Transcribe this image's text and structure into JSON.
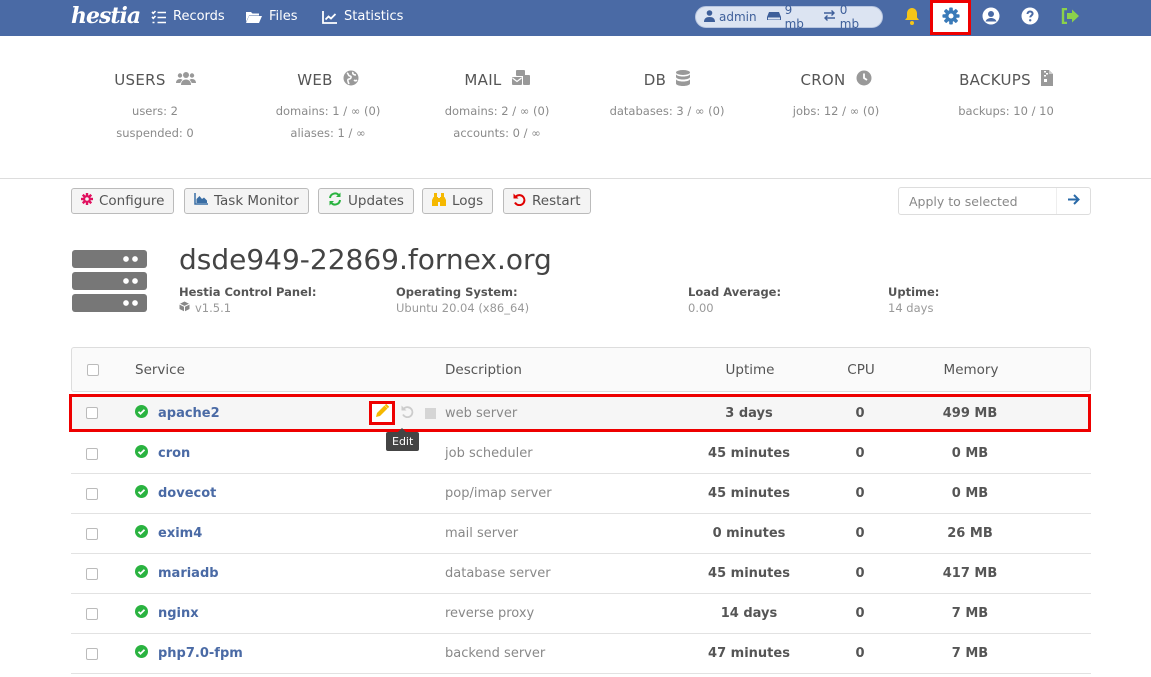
{
  "topbar": {
    "logo": "hestia",
    "nav": [
      {
        "label": "Records",
        "icon": "list-check-icon"
      },
      {
        "label": "Files",
        "icon": "folder-open-icon"
      },
      {
        "label": "Statistics",
        "icon": "chart-line-icon"
      }
    ],
    "user_pill": {
      "user": "admin",
      "disk": "9 mb",
      "bandwidth": "0 mb"
    },
    "icons": [
      "bell-icon",
      "gear-icon",
      "user-circle-icon",
      "question-icon",
      "logout-icon"
    ],
    "colors": {
      "bar": "#4a6aa5",
      "bell": "#f5c518",
      "gear": "#3a7ab8",
      "logout": "#8bd14b",
      "highlight": "#e00000"
    }
  },
  "stats": [
    {
      "title": "USERS",
      "icon": "users-icon",
      "lines": [
        "users: 2",
        "suspended: 0"
      ]
    },
    {
      "title": "WEB",
      "icon": "globe-icon",
      "lines": [
        "domains: 1 / ∞ (0)",
        "aliases: 1 / ∞"
      ]
    },
    {
      "title": "MAIL",
      "icon": "mail-bulk-icon",
      "lines": [
        "domains: 2 / ∞ (0)",
        "accounts: 0 / ∞"
      ]
    },
    {
      "title": "DB",
      "icon": "database-icon",
      "lines": [
        "databases: 3 / ∞ (0)"
      ]
    },
    {
      "title": "CRON",
      "icon": "clock-icon",
      "lines": [
        "jobs: 12 / ∞ (0)"
      ]
    },
    {
      "title": "BACKUPS",
      "icon": "file-archive-icon",
      "lines": [
        "backups: 10 / 10"
      ]
    }
  ],
  "toolbar": {
    "buttons": [
      {
        "label": "Configure",
        "icon": "cog-icon",
        "color": "#e0115f"
      },
      {
        "label": "Task Monitor",
        "icon": "chart-area-icon",
        "color": "#3a6ea5"
      },
      {
        "label": "Updates",
        "icon": "sync-icon",
        "color": "#2ab340"
      },
      {
        "label": "Logs",
        "icon": "binoculars-icon",
        "color": "#f5b800"
      },
      {
        "label": "Restart",
        "icon": "undo-icon",
        "color": "#e00000"
      }
    ],
    "apply_placeholder": "Apply to selected"
  },
  "server": {
    "hostname": "dsde949-22869.fornex.org",
    "info": [
      {
        "key": "Hestia Control Panel:",
        "value": "v1.5.1",
        "icon": "cube-icon"
      },
      {
        "key": "Operating System:",
        "value": "Ubuntu 20.04 (x86_64)"
      },
      {
        "key": "Load Average:",
        "value": "0.00"
      },
      {
        "key": "Uptime:",
        "value": "14 days"
      }
    ]
  },
  "table": {
    "headers": {
      "service": "Service",
      "description": "Description",
      "uptime": "Uptime",
      "cpu": "CPU",
      "memory": "Memory"
    },
    "rows": [
      {
        "service": "apache2",
        "description": "web server",
        "uptime": "3 days",
        "cpu": "0",
        "memory": "499 MB",
        "status": "running"
      },
      {
        "service": "cron",
        "description": "job scheduler",
        "uptime": "45 minutes",
        "cpu": "0",
        "memory": "0 MB",
        "status": "running"
      },
      {
        "service": "dovecot",
        "description": "pop/imap server",
        "uptime": "45 minutes",
        "cpu": "0",
        "memory": "0 MB",
        "status": "running"
      },
      {
        "service": "exim4",
        "description": "mail server",
        "uptime": "0 minutes",
        "cpu": "0",
        "memory": "26 MB",
        "status": "running"
      },
      {
        "service": "mariadb",
        "description": "database server",
        "uptime": "45 minutes",
        "cpu": "0",
        "memory": "417 MB",
        "status": "running"
      },
      {
        "service": "nginx",
        "description": "reverse proxy",
        "uptime": "14 days",
        "cpu": "0",
        "memory": "7 MB",
        "status": "running"
      },
      {
        "service": "php7.0-fpm",
        "description": "backend server",
        "uptime": "47 minutes",
        "cpu": "0",
        "memory": "7 MB",
        "status": "running"
      }
    ],
    "tooltip": "Edit"
  }
}
